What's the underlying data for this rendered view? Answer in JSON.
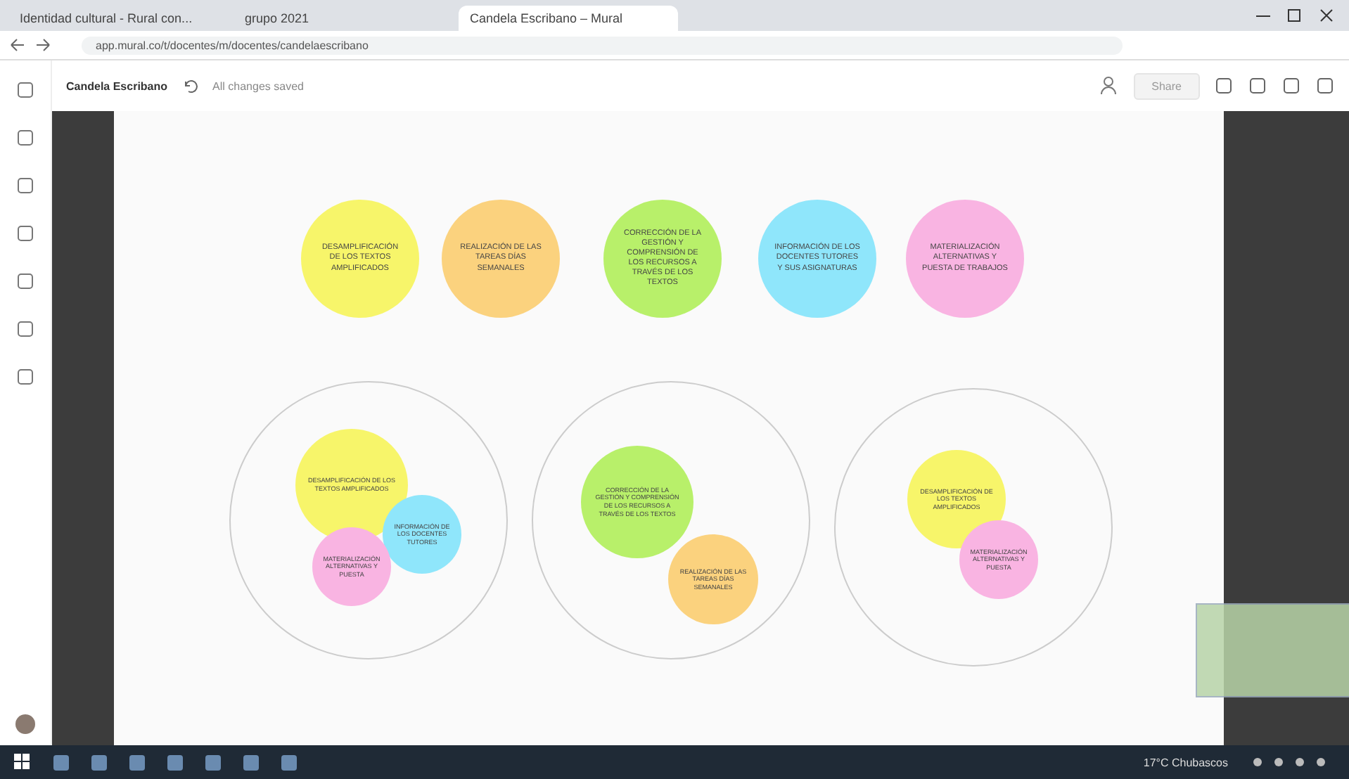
{
  "browser": {
    "tabs": [
      {
        "title": "Identidad cultural - Rural con...",
        "selected": false
      },
      {
        "title": "grupo 2021",
        "selected": false
      },
      {
        "title": "Candela Escribano – Mural",
        "selected": true
      }
    ],
    "url": "app.mural.co/t/docentes/m/docentes/candelaescribano"
  },
  "toolbar": {
    "title": "Candela Escribano",
    "status": "All changes saved",
    "share": "Share"
  },
  "ideas": [
    {
      "text": "DESAMPLIFICACIÓN DE LOS TEXTOS AMPLIFICADOS",
      "color": "#f7f56a"
    },
    {
      "text": "REALIZACIÓN DE LAS TAREAS DÍAS SEMANALES",
      "color": "#fbd27e"
    },
    {
      "text": "CORRECCIÓN DE LA GESTIÓN Y COMPRENSIÓN DE LOS RECURSOS A TRAVÉS DE LOS TEXTOS",
      "color": "#b8f06a"
    },
    {
      "text": "INFORMACIÓN DE LOS DOCENTES TUTORES Y SUS ASIGNATURAS",
      "color": "#8fe6fb"
    },
    {
      "text": "MATERIALIZACIÓN ALTERNATIVAS Y PUESTA DE TRABAJOS",
      "color": "#f9b4e2"
    }
  ],
  "groups": [
    {
      "items": [
        {
          "text": "DESAMPLIFICACIÓN DE LOS TEXTOS AMPLIFICADOS",
          "color": "#f7f56a"
        },
        {
          "text": "INFORMACIÓN DE LOS DOCENTES TUTORES",
          "color": "#8fe6fb"
        },
        {
          "text": "MATERIALIZACIÓN ALTERNATIVAS Y PUESTA",
          "color": "#f9b4e2"
        }
      ]
    },
    {
      "items": [
        {
          "text": "CORRECCIÓN DE LA GESTIÓN Y COMPRENSIÓN DE LOS RECURSOS A TRAVÉS DE LOS TEXTOS",
          "color": "#b8f06a"
        },
        {
          "text": "REALIZACIÓN DE LAS TAREAS DÍAS SEMANALES",
          "color": "#fbd27e"
        }
      ]
    },
    {
      "items": [
        {
          "text": "DESAMPLIFICACIÓN DE LOS TEXTOS AMPLIFICADOS",
          "color": "#f7f56a"
        },
        {
          "text": "MATERIALIZACIÓN ALTERNATIVAS Y PUESTA",
          "color": "#f9b4e2"
        }
      ]
    }
  ],
  "taskbar": {
    "weather": "17°C Chubascos"
  }
}
